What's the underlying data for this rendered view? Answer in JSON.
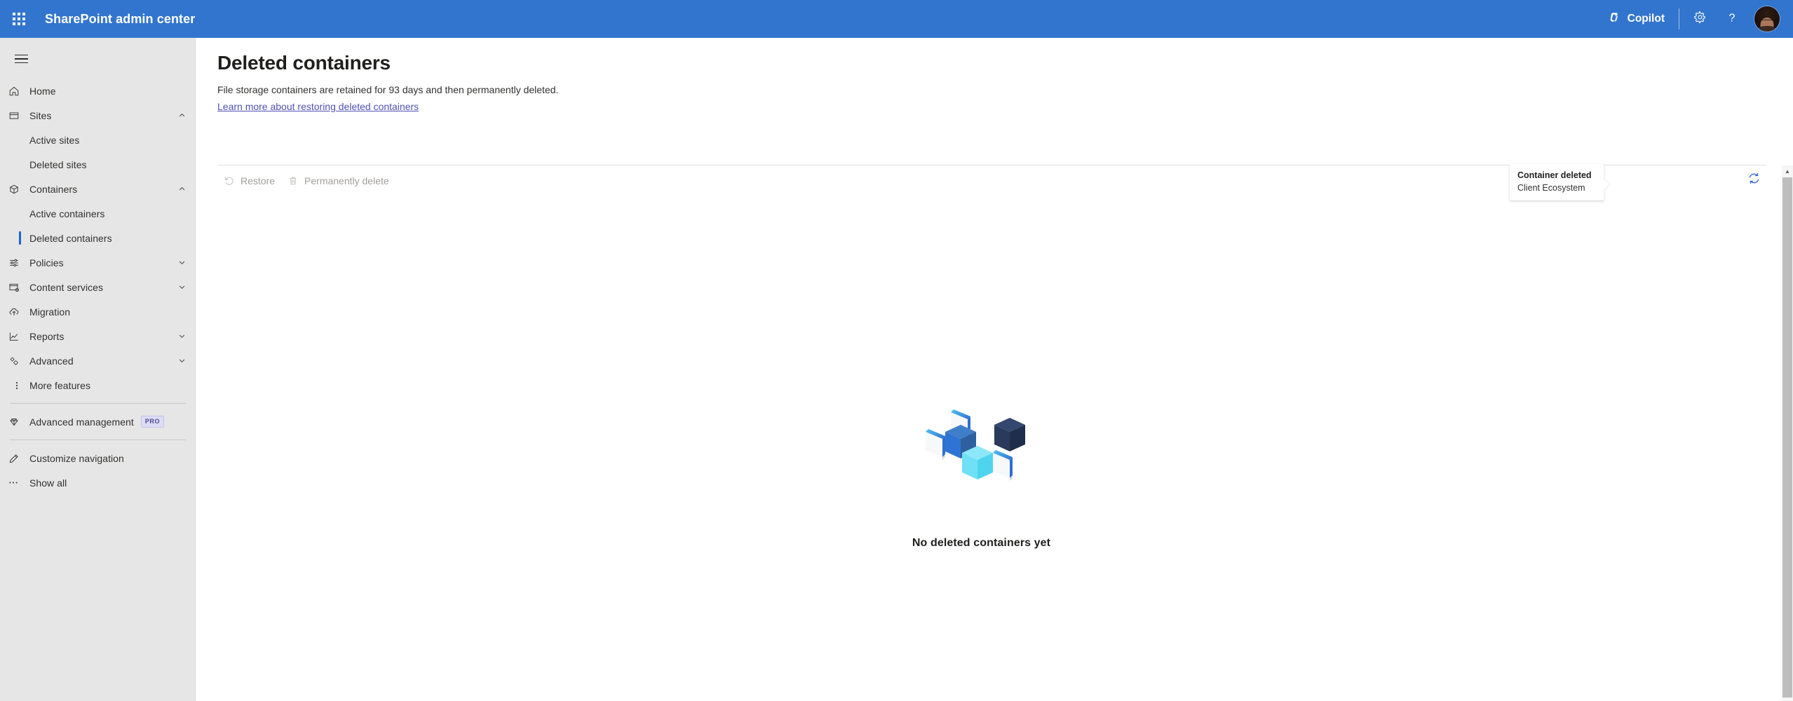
{
  "suite": {
    "waffle_label": "app-launcher",
    "title": "SharePoint admin center",
    "copilot_label": "Copilot",
    "settings_label": "Settings",
    "help_label": "Help",
    "account_label": "Account manager",
    "brand_color": "#3275ce"
  },
  "sidebar": {
    "hamburger_label": "Global navigation",
    "items": [
      {
        "label": "Home",
        "icon": "home-icon",
        "expandable": false
      },
      {
        "label": "Sites",
        "icon": "sites-icon",
        "expandable": true,
        "expanded": true
      },
      {
        "label": "Containers",
        "icon": "containers-icon",
        "expandable": true,
        "expanded": true
      },
      {
        "label": "Policies",
        "icon": "policies-icon",
        "expandable": true,
        "expanded": false
      },
      {
        "label": "Content services",
        "icon": "content-services-icon",
        "expandable": true,
        "expanded": false
      },
      {
        "label": "Migration",
        "icon": "migration-icon",
        "expandable": false
      },
      {
        "label": "Reports",
        "icon": "reports-icon",
        "expandable": true,
        "expanded": false
      },
      {
        "label": "Advanced",
        "icon": "advanced-icon",
        "expandable": true,
        "expanded": false
      },
      {
        "label": "More features",
        "icon": "more-features-icon",
        "expandable": false
      }
    ],
    "sites_children": [
      {
        "label": "Active sites",
        "active": false
      },
      {
        "label": "Deleted sites",
        "active": false
      }
    ],
    "containers_children": [
      {
        "label": "Active containers",
        "active": false
      },
      {
        "label": "Deleted containers",
        "active": true
      }
    ],
    "advanced_management": {
      "label": "Advanced management",
      "badge": "PRO",
      "icon": "diamond-icon"
    },
    "customize_navigation": {
      "label": "Customize navigation",
      "icon": "pencil-icon"
    },
    "show_all": {
      "label": "Show all",
      "icon": "ellipsis-icon"
    },
    "active_indicator_color": "#2266cc"
  },
  "page": {
    "title": "Deleted containers",
    "description": "File storage containers are retained for 93 days and then permanently deleted.",
    "link_text": "Learn more about restoring deleted containers",
    "link_color": "#4f52b2"
  },
  "command_bar": {
    "restore": {
      "label": "Restore",
      "icon": "restore-arrow-icon",
      "disabled": true
    },
    "permanently_delete": {
      "label": "Permanently delete",
      "icon": "trash-icon",
      "disabled": true
    },
    "refresh": {
      "label": "Refresh",
      "icon": "refresh-icon",
      "color": "#2b62d9"
    }
  },
  "tooltip": {
    "title": "Container deleted",
    "subtitle": "Client Ecosystem"
  },
  "empty_state": {
    "illustration": "isometric-containers-illustration",
    "message": "No deleted containers yet"
  },
  "scrollbar": {
    "up_arrow": "▲"
  }
}
